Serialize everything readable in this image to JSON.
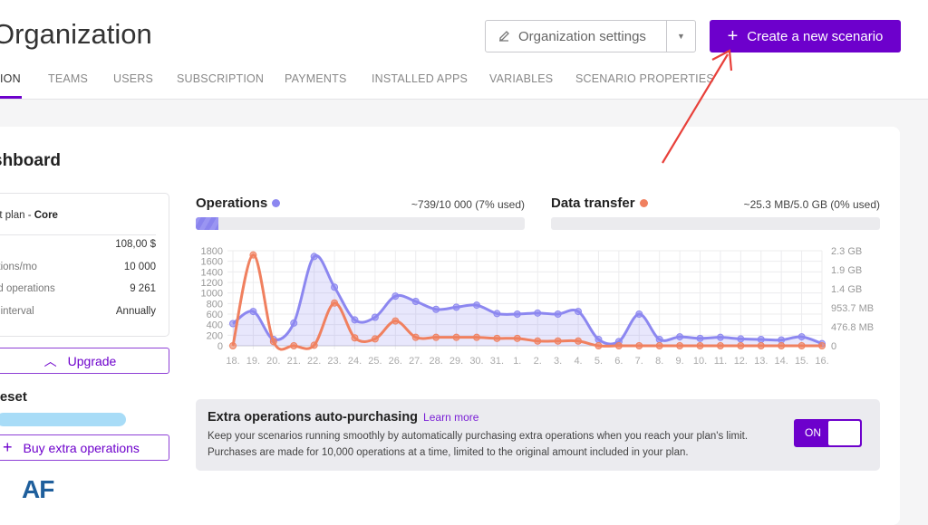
{
  "header": {
    "title": "Organization",
    "settings_label": "Organization settings",
    "create_label": "Create a new scenario"
  },
  "tabs": [
    {
      "label": "ION",
      "active": true
    },
    {
      "label": "TEAMS"
    },
    {
      "label": "USERS"
    },
    {
      "label": "SUBSCRIPTION"
    },
    {
      "label": "PAYMENTS"
    },
    {
      "label": "INSTALLED APPS"
    },
    {
      "label": "VARIABLES"
    },
    {
      "label": "SCENARIO PROPERTIES"
    }
  ],
  "dashboard": {
    "title": "shboard"
  },
  "plan": {
    "label": "nt plan - ",
    "name": "Core",
    "rows": [
      {
        "label": "",
        "value": "108,00 $"
      },
      {
        "label": "ations/mo",
        "value": "10 000"
      },
      {
        "label": "ed operations",
        "value": "9 261"
      },
      {
        "label": "g interval",
        "value": "Annually"
      }
    ],
    "upgrade_label": "Upgrade"
  },
  "reset": {
    "title": "reset",
    "buy_label": "Buy extra operations"
  },
  "logo": "AF",
  "operations": {
    "title": "Operations",
    "usage": "~739/10 000 (7% used)",
    "percent": 7,
    "color": "#8c87f0"
  },
  "transfer": {
    "title": "Data transfer",
    "usage": "~25.3 MB/5.0 GB (0% used)",
    "percent": 0,
    "color": "#f0805f"
  },
  "chart_data": {
    "type": "line",
    "x": [
      "18.",
      "19.",
      "20.",
      "21.",
      "22.",
      "23.",
      "24.",
      "25.",
      "26.",
      "27.",
      "28.",
      "29.",
      "30.",
      "31.",
      "1.",
      "2.",
      "3.",
      "4.",
      "5.",
      "6.",
      "7.",
      "8.",
      "9.",
      "10.",
      "11.",
      "12.",
      "13.",
      "14.",
      "15.",
      "16."
    ],
    "left_ticks": [
      "0",
      "200",
      "400",
      "600",
      "800",
      "1000",
      "1200",
      "1400",
      "1600",
      "1800"
    ],
    "right_ticks": [
      "0",
      "476.8 MB",
      "953.7 MB",
      "1.4 GB",
      "1.9 GB",
      "2.3 GB"
    ],
    "ylim_left": [
      0,
      1800
    ],
    "ylim_right_mb": [
      0,
      2384
    ],
    "grid": true,
    "series": [
      {
        "name": "Operations",
        "axis": "left",
        "color": "#8c87f0",
        "fill": true,
        "values": [
          420,
          650,
          120,
          430,
          1690,
          1110,
          490,
          540,
          940,
          840,
          690,
          730,
          770,
          610,
          600,
          620,
          600,
          650,
          120,
          80,
          600,
          120,
          170,
          140,
          160,
          130,
          120,
          110,
          170,
          40
        ]
      },
      {
        "name": "Data transfer",
        "axis": "right",
        "unit": "MB",
        "color": "#f0805f",
        "fill": false,
        "values": [
          0,
          2278,
          106,
          0,
          13,
          1073,
          199,
          172,
          622,
          212,
          212,
          212,
          212,
          185,
          185,
          119,
          119,
          119,
          0,
          0,
          0,
          0,
          0,
          0,
          0,
          0,
          0,
          0,
          0,
          0
        ]
      }
    ]
  },
  "auto": {
    "title": "Extra operations auto-purchasing",
    "learn_more": "Learn more",
    "description": "Keep your scenarios running smoothly by automatically purchasing extra operations when you reach your plan's limit. Purchases are made for 10,000 operations at a time, limited to the original amount included in your plan.",
    "toggle_label": "ON",
    "enabled": true
  },
  "colors": {
    "accent": "#6d00cc",
    "annotation_arrow": "#e8403a"
  }
}
